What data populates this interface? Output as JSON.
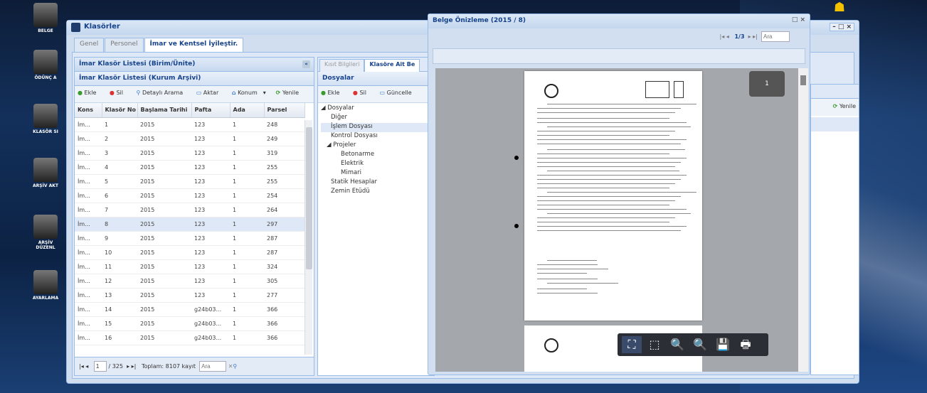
{
  "desktop": {
    "icons": [
      "BELGE",
      "ÖDÜNÇ A",
      "KLASÖR SI",
      "ARŞİV AKT",
      "ARŞİV DÜZENL",
      "AYARLAMA"
    ]
  },
  "window": {
    "title": "Klasörler",
    "controls": "– □ ×",
    "tabs": [
      {
        "label": "Genel"
      },
      {
        "label": "Personel"
      },
      {
        "label": "İmar ve Kentsel İyileştir."
      }
    ]
  },
  "left": {
    "header": "İmar Klasör Listesi (Birim/Ünite)",
    "sub": "İmar Klasör Listesi (Kurum Arşivi)",
    "tb": {
      "add": "Ekle",
      "del": "Sil",
      "search": "Detaylı Arama",
      "export": "Aktar",
      "location": "Konum",
      "refresh": "Yenile"
    },
    "columns": [
      "Kons",
      "Klasör No",
      "Başlama Tarihi",
      "Pafta",
      "Ada",
      "Parsel"
    ],
    "rows": [
      [
        "İm...",
        "1",
        "2015",
        "123",
        "1",
        "248"
      ],
      [
        "İm...",
        "2",
        "2015",
        "123",
        "1",
        "249"
      ],
      [
        "İm...",
        "3",
        "2015",
        "123",
        "1",
        "319"
      ],
      [
        "İm...",
        "4",
        "2015",
        "123",
        "1",
        "255"
      ],
      [
        "İm...",
        "5",
        "2015",
        "123",
        "1",
        "255"
      ],
      [
        "İm...",
        "6",
        "2015",
        "123",
        "1",
        "254"
      ],
      [
        "İm...",
        "7",
        "2015",
        "123",
        "1",
        "264"
      ],
      [
        "İm...",
        "8",
        "2015",
        "123",
        "1",
        "297"
      ],
      [
        "İm...",
        "9",
        "2015",
        "123",
        "1",
        "287"
      ],
      [
        "İm...",
        "10",
        "2015",
        "123",
        "1",
        "287"
      ],
      [
        "İm...",
        "11",
        "2015",
        "123",
        "1",
        "324"
      ],
      [
        "İm...",
        "12",
        "2015",
        "123",
        "1",
        "305"
      ],
      [
        "İm...",
        "13",
        "2015",
        "123",
        "1",
        "277"
      ],
      [
        "İm...",
        "14",
        "2015",
        "g24b03...",
        "1",
        "366"
      ],
      [
        "İm...",
        "15",
        "2015",
        "g24b03...",
        "1",
        "366"
      ],
      [
        "İm...",
        "16",
        "2015",
        "g24b03...",
        "1",
        "366"
      ]
    ],
    "pager": {
      "prev": "|◂  ◂",
      "page": "1",
      "total": "/ 325",
      "next": "▸  ▸|",
      "count": "Toplam: 8107 kayıt",
      "search": "Ara"
    }
  },
  "middle": {
    "tabs": [
      "Kısıt Bilgileri",
      "Klasöre Ait Be"
    ],
    "header": "Dosyalar",
    "tb": {
      "add": "Ekle",
      "del": "Sil",
      "update": "Güncelle"
    },
    "tree": [
      "◢ Dosyalar",
      "Diğer",
      "İşlem Dosyası",
      "Kontrol Dosyası",
      "◢ Projeler",
      "Betonarme",
      "Elektrik",
      "Mimari",
      "Statik Hesaplar",
      "Zemin Etüdü"
    ]
  },
  "preview": {
    "title": "Belge Önizleme (2015 / 8)",
    "controls": "□ ×",
    "page": "1/3",
    "nav_prev": "|◂  ◂",
    "nav_next": "▸  ▸|",
    "search": "Ara",
    "badge": "1",
    "tools": [
      "⛶",
      "⬚",
      "🔍",
      "🔍",
      "💾",
      "🖶"
    ]
  },
  "right_tab": {
    "refresh": "Yenile"
  }
}
